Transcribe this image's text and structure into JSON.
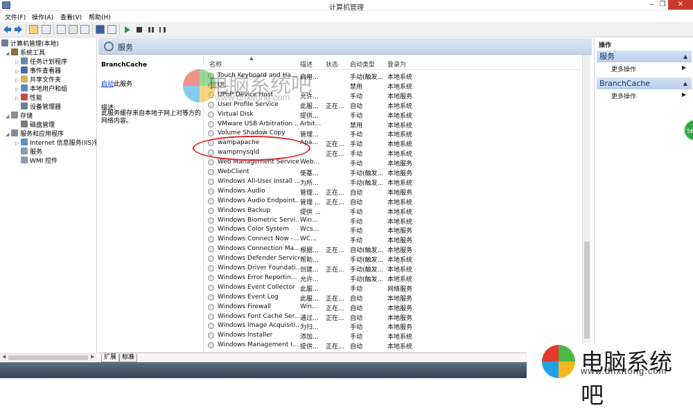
{
  "window": {
    "title": "计算机管理",
    "min": "‒",
    "restore": "❐",
    "close": "✕"
  },
  "menu": [
    "文件(F)",
    "操作(A)",
    "查看(V)",
    "帮助(H)"
  ],
  "tree": [
    {
      "label": "计算机管理(本地)",
      "indent": 0,
      "exp": "",
      "color": "#6b7d99"
    },
    {
      "label": "系统工具",
      "indent": 1,
      "exp": "◢",
      "color": "#8d6b3a"
    },
    {
      "label": "任务计划程序",
      "indent": 2,
      "exp": "▷",
      "color": "#6b88b0"
    },
    {
      "label": "事件查看器",
      "indent": 2,
      "exp": "▷",
      "color": "#4b6ea3"
    },
    {
      "label": "共享文件夹",
      "indent": 2,
      "exp": "▷",
      "color": "#d8b25a"
    },
    {
      "label": "本地用户和组",
      "indent": 2,
      "exp": "▷",
      "color": "#5a8bc0"
    },
    {
      "label": "性能",
      "indent": 2,
      "exp": "▷",
      "color": "#c44f3c"
    },
    {
      "label": "设备管理器",
      "indent": 2,
      "exp": "",
      "color": "#6c7f93"
    },
    {
      "label": "存储",
      "indent": 1,
      "exp": "◢",
      "color": "#8c8c8c"
    },
    {
      "label": "磁盘管理",
      "indent": 2,
      "exp": "",
      "color": "#7d7d7d"
    },
    {
      "label": "服务和应用程序",
      "indent": 1,
      "exp": "◢",
      "color": "#7d8ca0"
    },
    {
      "label": "Internet 信息服务(IIS)管",
      "indent": 2,
      "exp": "▷",
      "color": "#5d8fc8"
    },
    {
      "label": "服务",
      "indent": 2,
      "exp": "",
      "color": "#8d9aaa"
    },
    {
      "label": "WMI 控件",
      "indent": 2,
      "exp": "",
      "color": "#8d9aaa"
    }
  ],
  "center": {
    "title": "服务",
    "desc_title": "BranchCache",
    "desc_link": "启动",
    "desc_link_suffix": "此服务",
    "desc_label": "描述:",
    "desc_text": "此服务缓存来自本地子网上对等方的网络内容。"
  },
  "columns": [
    "名称",
    "描述",
    "状态",
    "启动类型",
    "登录为"
  ],
  "services": [
    {
      "name": "Touch Keyboard and Ha...",
      "desc": "启用...",
      "status": "",
      "start": "手动(触发...",
      "logon": "本地系统"
    },
    {
      "name": "UI...",
      "desc": "",
      "status": "",
      "start": "禁用",
      "logon": "本地系统"
    },
    {
      "name": "UPnP Device Host",
      "desc": "允许...",
      "status": "",
      "start": "手动",
      "logon": "本地服务"
    },
    {
      "name": "User Profile Service",
      "desc": "此服...",
      "status": "正在...",
      "start": "自动",
      "logon": "本地系统"
    },
    {
      "name": "Virtual Disk",
      "desc": "提供...",
      "status": "",
      "start": "手动",
      "logon": "本地系统"
    },
    {
      "name": "VMware USB Arbitration ...",
      "desc": "Arbit...",
      "status": "",
      "start": "禁用",
      "logon": "本地系统"
    },
    {
      "name": "Volume Shadow Copy",
      "desc": "管理...",
      "status": "",
      "start": "手动",
      "logon": "本地系统"
    },
    {
      "name": "wampapache",
      "desc": "Apa...",
      "status": "正在...",
      "start": "手动",
      "logon": "本地系统"
    },
    {
      "name": "wampmysqld",
      "desc": "",
      "status": "正在...",
      "start": "手动",
      "logon": "本地系统"
    },
    {
      "name": "Web Management Service",
      "desc": "Web...",
      "status": "",
      "start": "手动",
      "logon": "本地服务"
    },
    {
      "name": "WebClient",
      "desc": "使基...",
      "status": "",
      "start": "手动(触发...",
      "logon": "本地服务"
    },
    {
      "name": "Windows All-User Install ...",
      "desc": "为所...",
      "status": "",
      "start": "手动(触发...",
      "logon": "本地系统"
    },
    {
      "name": "Windows Audio",
      "desc": "管理...",
      "status": "正在...",
      "start": "自动",
      "logon": "本地服务"
    },
    {
      "name": "Windows Audio Endpoint...",
      "desc": "管理 ...",
      "status": "正在...",
      "start": "自动",
      "logon": "本地系统"
    },
    {
      "name": "Windows Backup",
      "desc": "提供 ...",
      "status": "",
      "start": "手动",
      "logon": "本地系统"
    },
    {
      "name": "Windows Biometric Servi...",
      "desc": "Win...",
      "status": "",
      "start": "手动",
      "logon": "本地系统"
    },
    {
      "name": "Windows Color System",
      "desc": "Wcs...",
      "status": "",
      "start": "手动",
      "logon": "本地服务"
    },
    {
      "name": "Windows Connect Now -...",
      "desc": "WC...",
      "status": "",
      "start": "手动",
      "logon": "本地服务"
    },
    {
      "name": "Windows Connection Ma...",
      "desc": "根据...",
      "status": "正在...",
      "start": "自动(触发...",
      "logon": "本地服务"
    },
    {
      "name": "Windows Defender Service",
      "desc": "帮助...",
      "status": "",
      "start": "手动(触发...",
      "logon": "本地系统"
    },
    {
      "name": "Windows Driver Foundati...",
      "desc": "创建...",
      "status": "正在...",
      "start": "手动(触发...",
      "logon": "本地系统"
    },
    {
      "name": "Windows Error Reportin...",
      "desc": "允许...",
      "status": "",
      "start": "手动(触发...",
      "logon": "本地系统"
    },
    {
      "name": "Windows Event Collector",
      "desc": "此服...",
      "status": "",
      "start": "手动",
      "logon": "网络服务"
    },
    {
      "name": "Windows Event Log",
      "desc": "此服...",
      "status": "正在...",
      "start": "自动",
      "logon": "本地服务"
    },
    {
      "name": "Windows Firewall",
      "desc": "Win...",
      "status": "正在...",
      "start": "自动",
      "logon": "本地服务"
    },
    {
      "name": "Windows Font Cache Ser...",
      "desc": "通过...",
      "status": "正在...",
      "start": "自动",
      "logon": "本地服务"
    },
    {
      "name": "Windows Image Acquisiti...",
      "desc": "为扫...",
      "status": "",
      "start": "手动",
      "logon": "本地服务"
    },
    {
      "name": "Windows Installer",
      "desc": "添加...",
      "status": "",
      "start": "手动",
      "logon": "本地系统"
    },
    {
      "name": "Windows Management I...",
      "desc": "提供...",
      "status": "正在...",
      "start": "自动",
      "logon": "本地系统"
    }
  ],
  "tabs": [
    "扩展",
    "标准"
  ],
  "actions": {
    "title": "操作",
    "sections": [
      {
        "label": "服务",
        "item": "更多操作"
      },
      {
        "label": "BranchCache",
        "item": "更多操作"
      }
    ],
    "badge": "56"
  },
  "watermark": {
    "text": "电脑系统吧",
    "url": "www.dnxitong.com"
  }
}
